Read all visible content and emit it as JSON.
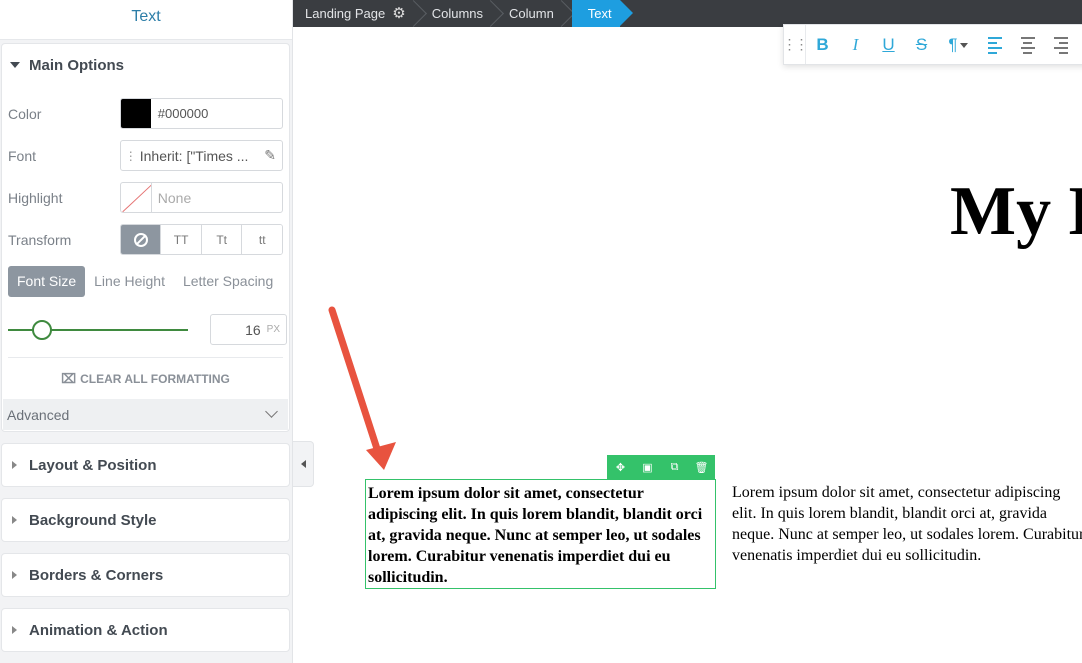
{
  "panel": {
    "title": "Text",
    "main_options": {
      "header": "Main Options",
      "color": {
        "label": "Color",
        "value": "#000000",
        "swatch": "#000000"
      },
      "font": {
        "label": "Font",
        "value": "Inherit: [\"Times ..."
      },
      "highlight": {
        "label": "Highlight",
        "value": "None"
      },
      "transform": {
        "label": "Transform",
        "options": [
          "none",
          "TT",
          "Tt",
          "tt"
        ],
        "selected": "none"
      },
      "typography_tabs": [
        "Font Size",
        "Line Height",
        "Letter Spacing"
      ],
      "active_tab": "Font Size",
      "font_size": {
        "value": "16",
        "unit": "PX",
        "slider_fraction": 0.19
      },
      "clear_formatting": "CLEAR ALL FORMATTING",
      "advanced": "Advanced"
    },
    "sections": [
      "Layout & Position",
      "Background Style",
      "Borders & Corners",
      "Animation & Action"
    ]
  },
  "breadcrumb": [
    "Landing Page",
    "Columns",
    "Column",
    "Text"
  ],
  "toolbar": {
    "bold": "B",
    "italic": "I",
    "underline": "U",
    "strike": "S",
    "paragraph": "¶"
  },
  "canvas": {
    "heading": "My L",
    "selected_text": "Lorem ipsum dolor sit amet, consectetur adipiscing elit. In quis lorem blandit, blandit orci at, gravida neque. Nunc at semper leo, ut sodales lorem. Curabitur venenatis imperdiet dui eu sollicitudin.",
    "plain_text": "Lorem ipsum dolor sit amet, consectetur adipiscing elit. In quis lorem blandit, blandit orci at, gravida neque. Nunc at semper leo, ut sodales lorem. Curabitur venenatis imperdiet dui eu sollicitudin."
  },
  "colors": {
    "accent": "#2d7ea8",
    "active_crumb": "#1e9ee0",
    "selection": "#34c26a",
    "slider": "#3f8a3f",
    "arrow": "#e8533f"
  },
  "icons": [
    "gear-icon",
    "drag-handle-icon",
    "move-icon",
    "save-icon",
    "duplicate-icon",
    "trash-icon",
    "pencil-icon",
    "no-transform-icon",
    "clear-format-icon",
    "chevron-down-icon",
    "collapse-panel-icon"
  ]
}
